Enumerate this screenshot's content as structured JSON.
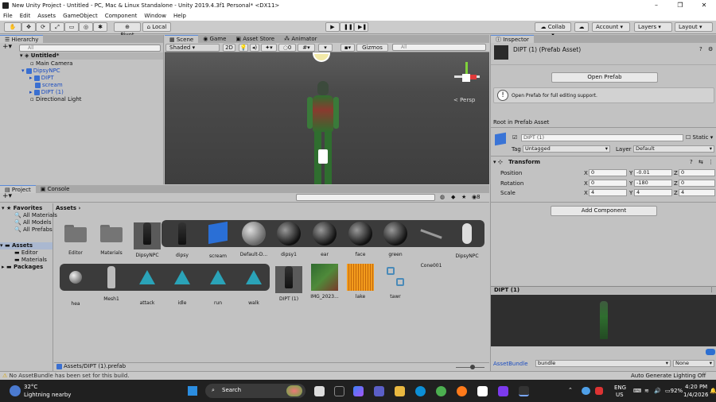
{
  "window": {
    "title": "New Unity Project - Untitled - PC, Mac & Linux Standalone - Unity 2019.4.3f1 Personal* <DX11>"
  },
  "menu": [
    "File",
    "Edit",
    "Assets",
    "GameObject",
    "Component",
    "Window",
    "Help"
  ],
  "toolbar": {
    "pivot": "Pivot",
    "local": "Local",
    "collab": "Collab",
    "account": "Account",
    "layers": "Layers",
    "layout": "Layout"
  },
  "hierarchy": {
    "tab": "Hierarchy",
    "search": "All",
    "scene": "Untitled*",
    "items": [
      "Main Camera",
      "DipsyNPC",
      "DIPT",
      "scream",
      "DIPT (1)",
      "Directional Light"
    ]
  },
  "scene": {
    "tabs": [
      "Scene",
      "Game",
      "Asset Store",
      "Animator"
    ],
    "shading": "Shaded",
    "mode2d": "2D",
    "gizmos": "Gizmos",
    "search": "All",
    "persp": "< Persp",
    "fx_count": "0"
  },
  "project": {
    "tabs": [
      "Project",
      "Console"
    ],
    "favorites": "Favorites",
    "fav_items": [
      "All Materials",
      "All Models",
      "All Prefabs"
    ],
    "assets_root": "Assets",
    "asset_children": [
      "Editor",
      "Materials"
    ],
    "packages": "Packages",
    "breadcrumb": "Assets",
    "count": "8",
    "path": "Assets/DIPT (1).prefab"
  },
  "assets_row1": [
    "Editor",
    "Materials",
    "DipsyNPC",
    "dipsy",
    "scream",
    "Default-D...",
    "dipsy1",
    "ear",
    "face",
    "green",
    "Cone001",
    "DipsyNPC"
  ],
  "assets_row2": [
    "hea",
    "Mesh1",
    "attack",
    "idle",
    "run",
    "walk",
    "DIPT (1)",
    "IMG_2023...",
    "lake",
    "tawr"
  ],
  "inspector": {
    "tab": "Inspector",
    "title": "DIPT (1) (Prefab Asset)",
    "open_prefab": "Open Prefab",
    "help": "Open Prefab for full editing support.",
    "root": "Root in Prefab Asset",
    "name": "DIPT (1)",
    "static": "Static",
    "tag_label": "Tag",
    "tag": "Untagged",
    "layer_label": "Layer",
    "layer": "Default",
    "transform": "Transform",
    "position": "Position",
    "rotation": "Rotation",
    "scale": "Scale",
    "pos": [
      "0",
      "-0.01",
      "0"
    ],
    "rot": [
      "0",
      "-180",
      "0"
    ],
    "scl": [
      "4",
      "4",
      "4"
    ],
    "add_component": "Add Component",
    "preview": "DIPT (1)",
    "assetbundle_label": "AssetBundle",
    "assetbundle": "bundle",
    "variant": "None"
  },
  "status": {
    "message": "No AssetBundle has been set for this build.",
    "lighting": "Auto Generate Lighting Off"
  },
  "taskbar": {
    "temp": "32°C",
    "weather": "Lightning nearby",
    "search": "Search",
    "lang": "ENG",
    "region": "US",
    "battery": "92%",
    "time": "4:20 PM",
    "date": "1/4/2026"
  }
}
